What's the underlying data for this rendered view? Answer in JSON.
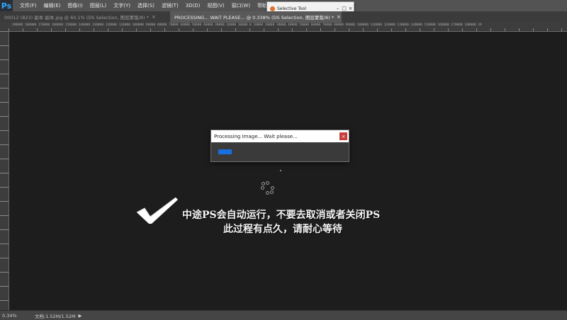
{
  "menu": {
    "logo": "Ps",
    "items": [
      "文件(F)",
      "编辑(E)",
      "图像(I)",
      "图层(L)",
      "文字(Y)",
      "选择(S)",
      "滤镜(T)",
      "3D(D)",
      "视图(V)",
      "窗口(W)",
      "帮助(H)"
    ]
  },
  "selective_tool": {
    "title": "Selective Tool",
    "minimize": "–",
    "restore": "□",
    "close": "×"
  },
  "tabs": {
    "inactive_label": "00012 (823) 副本 副本.jpg @ 60.1% (DS Selection, 图层蒙版/8) *",
    "active_label": "PROCESSING... WAIT PLEASE... @ 0.338% (DS Selection, 图层蒙版/8) *",
    "close_glyph": "×"
  },
  "ruler": {
    "labels": "|90000 180000 170000 160000 150000 140000 130000 120000 110000 100000 90000 80000 70000 60000 50000 40000 30000 20000 10000 0 10000 20000 30000 40000 50000 60000 70000 80000 90000 100000 110000 120000 130000 140000 150000 160000 170000 180000 19"
  },
  "dialog": {
    "title": "Processing Image... Wait please...",
    "close": "×",
    "progress": 0.19
  },
  "annotation": {
    "line1": "中途PS会自动运行，不要去取消或者关闭PS",
    "line2": "此过程有点久，请耐心等待"
  },
  "status": {
    "zoom": "0.34%",
    "doc": "文档:1.52M/1.52M",
    "arrow": "▶"
  },
  "colors": {
    "progress_fill": "#1a6fe0",
    "close_button": "#c83c3c"
  }
}
